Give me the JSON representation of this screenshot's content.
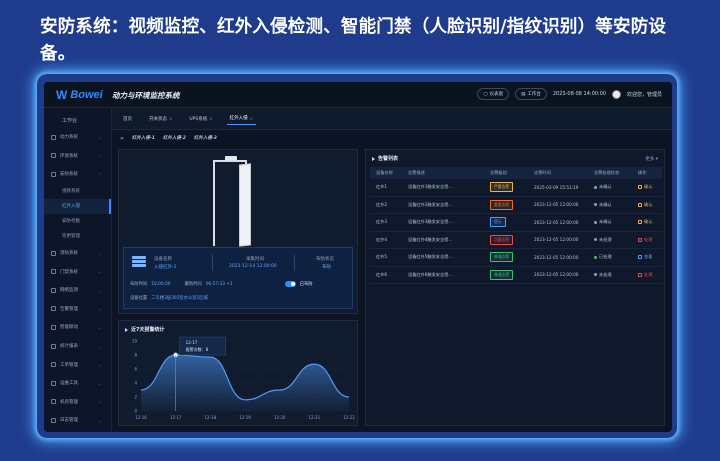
{
  "caption": "安防系统：视频监控、红外入侵检测、智能门禁（人脸识别/指纹识别）等安防设备。",
  "colors": {
    "background": "#1f3c8c",
    "accent": "#2f8bff",
    "screen": "#0c1424"
  },
  "topbar": {
    "logo": "Bowei",
    "logo_icon": "w-logo-icon",
    "title": "动力与环境监控系统",
    "btn1": "仪表盘",
    "btn2": "工作台",
    "datetime": "2023-08-08 14:00:00",
    "welcome": "欢迎您，管理员"
  },
  "sidebar": {
    "workspace": "工作台",
    "items": [
      {
        "label": "动力系统",
        "icon": "power-icon"
      },
      {
        "label": "环境系统",
        "icon": "env-icon"
      },
      {
        "label": "安防系统",
        "icon": "shield-icon"
      }
    ],
    "subitems": [
      "视频系统",
      "红外入侵",
      "安防考勤",
      "巡更管理"
    ],
    "items2": [
      {
        "label": "消防系统",
        "icon": "fire-icon"
      },
      {
        "label": "门禁系统",
        "icon": "door-icon"
      },
      {
        "label": "网络监测",
        "icon": "network-icon"
      },
      {
        "label": "告警管理",
        "icon": "alarm-icon"
      },
      {
        "label": "智能联动",
        "icon": "link-icon"
      },
      {
        "label": "统计报表",
        "icon": "report-icon"
      },
      {
        "label": "工单管理",
        "icon": "order-icon"
      },
      {
        "label": "运维工具",
        "icon": "tools-icon"
      },
      {
        "label": "机房管理",
        "icon": "room-icon"
      },
      {
        "label": "日志管理",
        "icon": "log-icon"
      }
    ]
  },
  "tabs": [
    "首页",
    "开关状态",
    "UPS系统",
    "红外入侵"
  ],
  "crumbs": [
    "红外入侵-1",
    "红外入侵-2",
    "红外入侵-3"
  ],
  "device": {
    "name_label": "设备名称",
    "name_value": "入侵红外-1",
    "time_label": "采集时间",
    "time_value": "2023-12-14 12:00:00",
    "status_label": "布防状态",
    "status_value": "布防",
    "alarm_time_label": "布防时间",
    "alarm_time_value": "10:00:00",
    "undefend_label": "撤防时间",
    "undefend_value": "06:57:33 +1",
    "armed_label": "已布防",
    "location_label": "设备位置",
    "location_value": "二号楼3层302室办公室1区域"
  },
  "chart_panel": {
    "title": "近7天报警统计"
  },
  "chart_data": {
    "type": "area",
    "x": [
      "12-16",
      "12-17",
      "12-18",
      "12-19",
      "12-20",
      "12-21",
      "12-22"
    ],
    "y": [
      3,
      8,
      7.7,
      1.6,
      3,
      6.7,
      2
    ],
    "yticks": [
      0,
      2,
      4,
      6,
      8,
      10
    ],
    "ylim": [
      0,
      10
    ],
    "tooltip": {
      "date": "12-17",
      "label": "报警次数：8"
    },
    "color": "#4f9cff"
  },
  "alarm_panel": {
    "title": "告警列表",
    "more": "更多"
  },
  "table": {
    "headers": [
      "设备名称",
      "告警描述",
      "告警级别",
      "告警时间",
      "告警处理状态",
      "操作"
    ],
    "rows": [
      {
        "name": "红外1",
        "desc": "设备红外1触发安全侵...",
        "level": "严重告警",
        "level_color": "#e8b34c",
        "time": "2025-03-09 15:51:19",
        "status": "未确认",
        "status_color": "#8ea0bd",
        "op": "确认",
        "op_color": "#e8b34c"
      },
      {
        "name": "红外2",
        "desc": "设备红外2触发安全侵...",
        "level": "重要告警",
        "level_color": "#e86f2c",
        "time": "2023-12-05 12:00:00",
        "status": "未确认",
        "status_color": "#8ea0bd",
        "op": "确认",
        "op_color": "#e8b34c"
      },
      {
        "name": "红外3",
        "desc": "设备红外3触发安全侵...",
        "level": "提示",
        "level_color": "#4f9cff",
        "time": "2023-12-05 12:00:00",
        "status": "未确认",
        "status_color": "#8ea0bd",
        "op": "确认",
        "op_color": "#e8b34c"
      },
      {
        "name": "红外4",
        "desc": "设备红外4触发安全侵...",
        "level": "次要告警",
        "level_color": "#e24c4c",
        "time": "2023-12-05 12:00:00",
        "status": "未处理",
        "status_color": "#8ea0bd",
        "op": "处理",
        "op_color": "#e24c4c"
      },
      {
        "name": "红外5",
        "desc": "设备红外5触发安全侵...",
        "level": "普通告警",
        "level_color": "#3fbf75",
        "time": "2023-12-05 12:00:00",
        "status": "已处理",
        "status_color": "#3fbf75",
        "op": "查看",
        "op_color": "#4f9cff"
      },
      {
        "name": "红外6",
        "desc": "设备红外6触发安全侵...",
        "level": "普通告警",
        "level_color": "#3fbf75",
        "time": "2023-12-05 12:00:00",
        "status": "未处理",
        "status_color": "#8ea0bd",
        "op": "处理",
        "op_color": "#e24c4c"
      }
    ]
  }
}
